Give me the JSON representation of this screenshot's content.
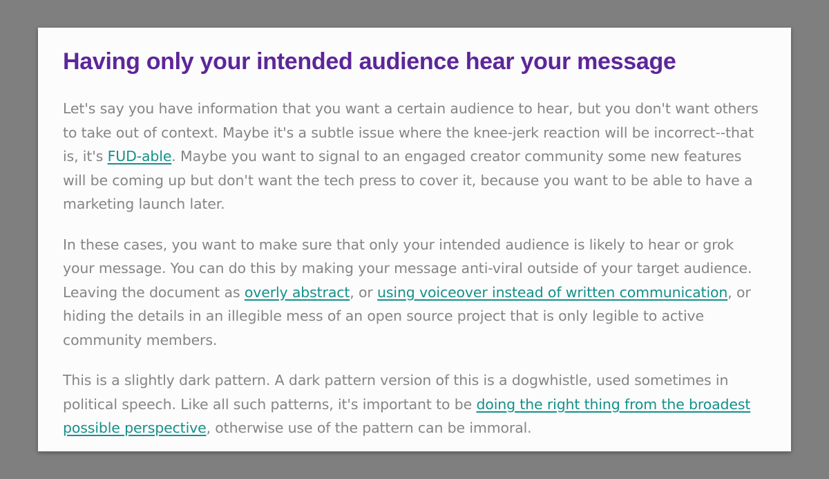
{
  "article": {
    "title": "Having only your intended audience hear your message",
    "paragraphs": [
      {
        "t1": "Let's say you have information that you want a certain audience to hear, but you don't want others to take out of context. Maybe it's a subtle issue where the knee-jerk reaction will be incorrect--that is, it's ",
        "link1": "FUD-able",
        "t2": ". Maybe you want to signal to an engaged creator community some new features will be coming up but don't want the tech press to cover it, because you want to be able to have a marketing launch later."
      },
      {
        "t1": "In these cases, you want to make sure that only your intended audience is likely to hear or grok your message. You can do this by making your message anti-viral outside of your target audience. Leaving the document as ",
        "link1": "overly abstract",
        "t2": ", or ",
        "link2": "using voiceover instead of written communication",
        "t3": ", or hiding the details in an illegible mess of an open source project that is only legible to active community members."
      },
      {
        "t1": "This is a slightly dark pattern. A dark pattern version of this is a dogwhistle, used sometimes in political speech. Like all such patterns, it's important to be ",
        "link1": "doing the right thing from the broadest possible perspective",
        "t2": ", otherwise use of the pattern can be immoral."
      }
    ]
  },
  "colors": {
    "background": "#7f7f7f",
    "card": "#fcfcfc",
    "title": "#5d2699",
    "body_text": "#858585",
    "link": "#15908a"
  }
}
